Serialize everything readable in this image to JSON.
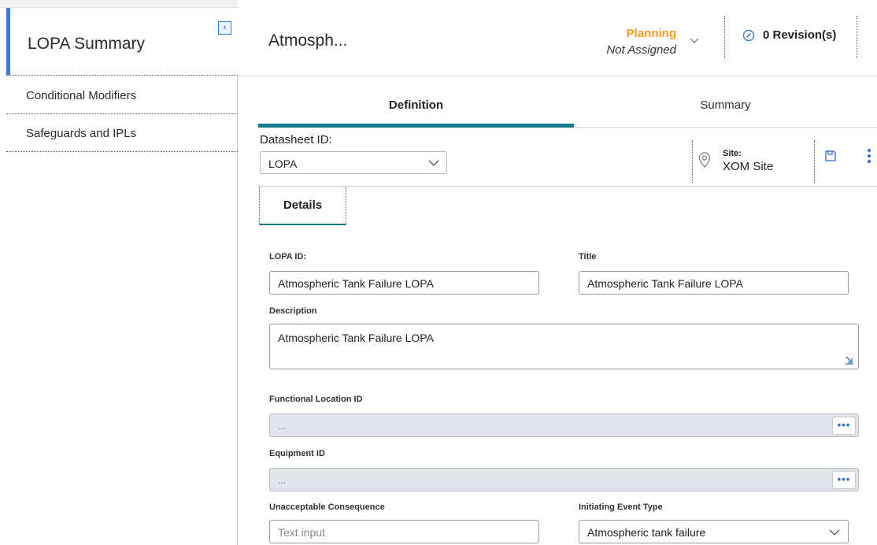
{
  "sidebar": {
    "active_item": "LOPA Summary",
    "items": [
      {
        "label": "Conditional Modifiers"
      },
      {
        "label": "Safeguards and IPLs"
      }
    ]
  },
  "header": {
    "record_title": "Atmosph...",
    "state": "Planning",
    "state_assignee": "Not Assigned",
    "revisions": "0 Revision(s)"
  },
  "tabs": [
    {
      "label": "Definition",
      "active": true
    },
    {
      "label": "Summary",
      "active": false
    }
  ],
  "datasheet": {
    "label": "Datasheet ID:",
    "value": "LOPA"
  },
  "site": {
    "label": "Site:",
    "value": "XOM Site"
  },
  "section_tab": "Details",
  "form": {
    "lopa_id": {
      "label": "LOPA ID:",
      "value": "Atmospheric Tank Failure LOPA"
    },
    "title": {
      "label": "Title",
      "value": "Atmospheric Tank Failure LOPA"
    },
    "description": {
      "label": "Description",
      "value": "Atmospheric Tank Failure LOPA"
    },
    "functional_location": {
      "label": "Functional Location ID",
      "value": "..."
    },
    "equipment": {
      "label": "Equipment ID",
      "value": "..."
    },
    "unacceptable_consequence": {
      "label": "Unacceptable Consequence",
      "placeholder": "Text input"
    },
    "initiating_event_type": {
      "label": "Initiating Event Type",
      "value": "Atmospheric tank failure"
    },
    "ellipsis": "•••"
  },
  "colors": {
    "accent_blue": "#3a7bd5",
    "tab_teal": "#147a8c",
    "state_orange": "#f39c23"
  }
}
